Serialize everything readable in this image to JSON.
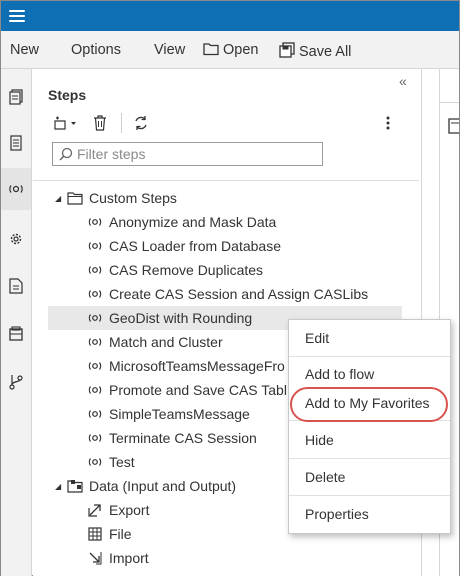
{
  "menubar": {
    "new_label": "New",
    "options_label": "Options",
    "view_label": "View",
    "open_label": "Open",
    "save_all_label": "Save All"
  },
  "rail": {
    "icons": [
      "document-icon",
      "page-icon",
      "steps-icon",
      "gear-icon",
      "file-code-icon",
      "library-icon",
      "git-icon"
    ]
  },
  "steps_panel": {
    "title": "Steps",
    "collapse_glyph": "«",
    "filter_placeholder": "Filter steps",
    "groups": [
      {
        "label": "Custom Steps",
        "items": [
          "Anonymize and Mask Data",
          "CAS Loader from Database",
          "CAS Remove Duplicates",
          "Create CAS Session and Assign CASLibs",
          "GeoDist with Rounding",
          "Match and Cluster",
          "MicrosoftTeamsMessageFro",
          "Promote and Save CAS Tabl",
          "SimpleTeamsMessage",
          "Terminate CAS Session",
          "Test"
        ],
        "selected_item": "GeoDist with Rounding"
      },
      {
        "label": "Data (Input and Output)",
        "items": [
          "Export",
          "File",
          "Import"
        ]
      }
    ]
  },
  "context_menu": {
    "items": [
      "Edit",
      "Add to flow",
      "Add to My Favorites",
      "Hide",
      "Delete",
      "Properties"
    ],
    "highlighted": "Add to My Favorites"
  },
  "colors": {
    "topbar": "#0f6fb5",
    "highlight_ring": "#d9534f",
    "selected_row": "#e8e8e8"
  }
}
